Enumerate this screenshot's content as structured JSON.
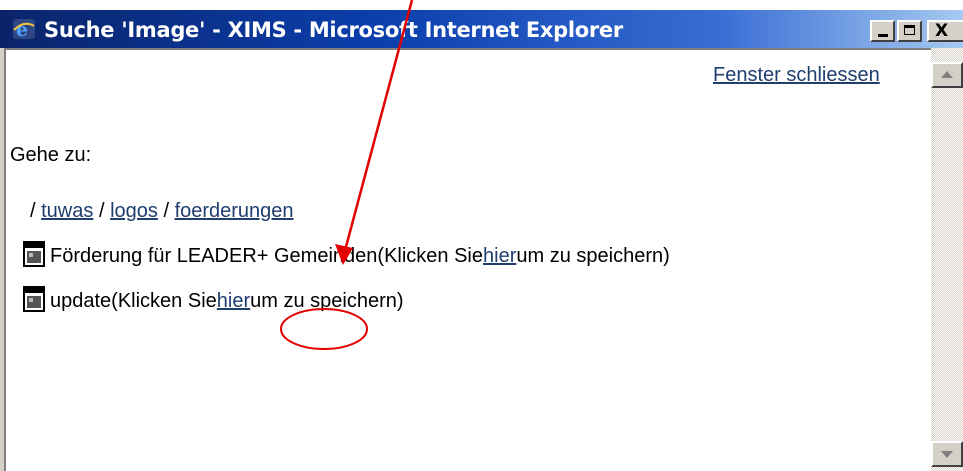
{
  "window": {
    "title": "Suche 'Image' - XIMS - Microsoft Internet Explorer",
    "close_glyph": "X"
  },
  "page": {
    "close_window_link": "Fenster schliessen",
    "goto_label": "Gehe zu:",
    "breadcrumb": {
      "sep": "/",
      "items": [
        "tuwas",
        "logos",
        "foerderungen"
      ]
    },
    "files": [
      {
        "name": "Förderung für LEADER+ Gemeinden",
        "prefix": " (Klicken Sie ",
        "link": "hier",
        "suffix": " um zu speichern)"
      },
      {
        "name": "update",
        "prefix": " (Klicken Sie ",
        "link": "hier",
        "suffix": " um zu speichern)"
      }
    ]
  },
  "icons": {
    "title": "ie-icon",
    "file": "document-icon"
  },
  "colors": {
    "link": "#1f3e6e",
    "annotation": "#e30000",
    "titlebar_start": "#0a246a",
    "titlebar_end": "#a6caf0"
  }
}
